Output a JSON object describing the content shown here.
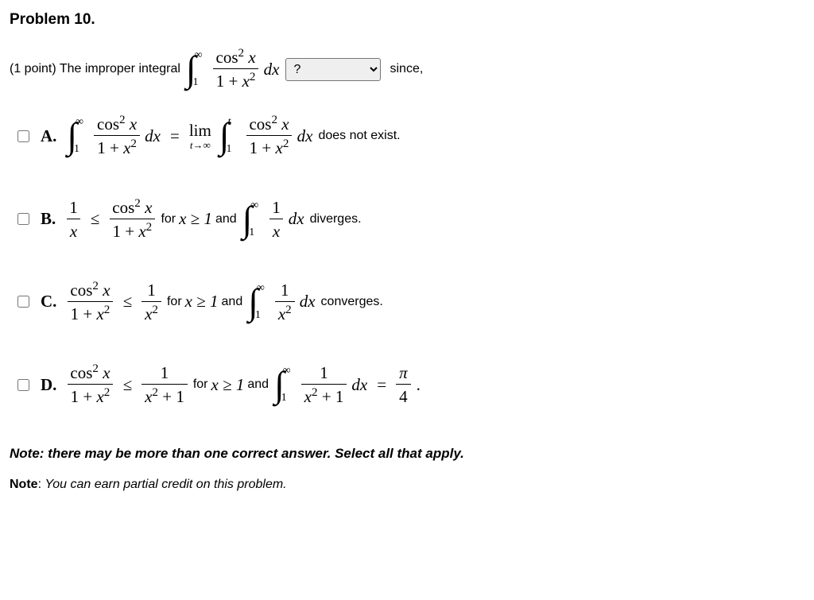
{
  "title": "Problem 10.",
  "question": {
    "prefix": "(1 point) The improper integral",
    "integral": {
      "lower": "1",
      "upper": "∞",
      "num_a": "cos",
      "num_exp": "2",
      "num_b": "x",
      "den_a": "1 + ",
      "den_b": "x",
      "den_exp": "2",
      "dx": "dx"
    },
    "select_placeholder": "?",
    "suffix": "since,"
  },
  "options": {
    "a": {
      "label": "A.",
      "int1": {
        "lower": "1",
        "upper": "∞",
        "num": "cos",
        "numexp": "2",
        "numvar": "x",
        "den1": "1 + ",
        "denvar": "x",
        "denexp": "2",
        "dx": "dx"
      },
      "eq": "=",
      "lim_top": "lim",
      "lim_bot": "t→∞",
      "int2": {
        "lower": "1",
        "upper": "t",
        "num": "cos",
        "numexp": "2",
        "numvar": "x",
        "den1": "1 + ",
        "denvar": "x",
        "denexp": "2",
        "dx": "dx"
      },
      "after": " does not exist."
    },
    "b": {
      "label": "B.",
      "lhs": {
        "num": "1",
        "den": "x"
      },
      "rel": "≤",
      "mid": {
        "num": "cos",
        "numexp": "2",
        "numvar": "x",
        "den1": "1 + ",
        "denvar": "x",
        "denexp": "2"
      },
      "for": " for ",
      "cond": "x ≥ 1",
      "and": " and ",
      "int": {
        "lower": "1",
        "upper": "∞",
        "num": "1",
        "den": "x",
        "dx": "dx"
      },
      "after": " diverges."
    },
    "c": {
      "label": "C.",
      "lhs": {
        "num": "cos",
        "numexp": "2",
        "numvar": "x",
        "den1": "1 + ",
        "denvar": "x",
        "denexp": "2"
      },
      "rel": "≤",
      "rhs": {
        "num": "1",
        "denvar": "x",
        "denexp": "2"
      },
      "for": " for ",
      "cond": "x ≥ 1",
      "and": " and ",
      "int": {
        "lower": "1",
        "upper": "∞",
        "num": "1",
        "denvar": "x",
        "denexp": "2",
        "dx": "dx"
      },
      "after": " converges."
    },
    "d": {
      "label": "D.",
      "lhs": {
        "num": "cos",
        "numexp": "2",
        "numvar": "x",
        "den1": "1 + ",
        "denvar": "x",
        "denexp": "2"
      },
      "rel": "≤",
      "rhs": {
        "num": "1",
        "denvar": "x",
        "denexp": "2",
        "denplus": " + 1"
      },
      "for": " for ",
      "cond": "x ≥ 1",
      "and": " and ",
      "int": {
        "lower": "1",
        "upper": "∞",
        "num": "1",
        "denvar": "x",
        "denexp": "2",
        "denplus": " + 1",
        "dx": "dx"
      },
      "eq": "=",
      "result": {
        "num": "π",
        "den": "4"
      },
      "period": "."
    }
  },
  "notes": {
    "multi": "Note: there may be more than one correct answer. Select all that apply.",
    "partial_label": "Note",
    "partial_colon": ": ",
    "partial_text": "You can earn partial credit on this problem."
  }
}
